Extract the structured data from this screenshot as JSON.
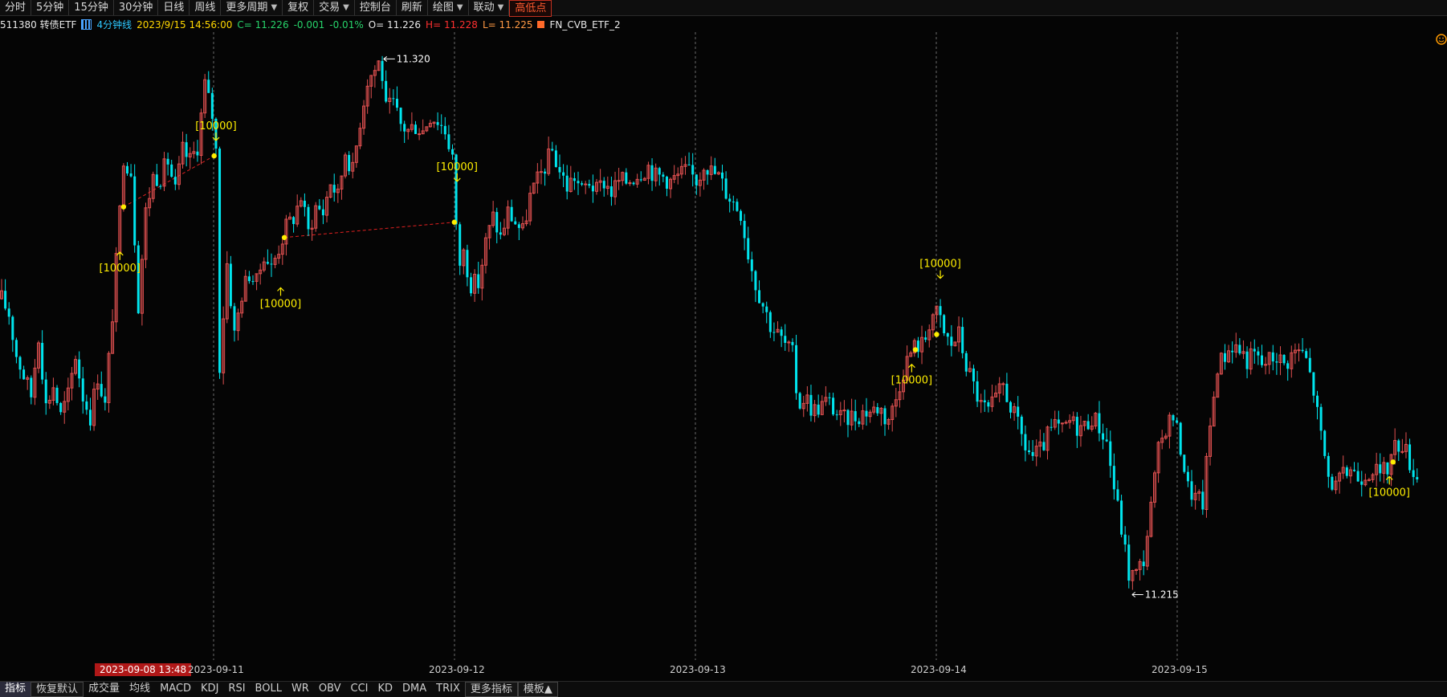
{
  "toolbar": {
    "items": [
      "分时",
      "5分钟",
      "15分钟",
      "30分钟",
      "日线",
      "周线",
      "更多周期",
      "复权",
      "交易",
      "控制台",
      "刷新",
      "绘图",
      "联动",
      "高低点"
    ]
  },
  "info": {
    "code": "511380 转债ETF",
    "period": "4分钟线",
    "datetime": "2023/9/15 14:56:00",
    "close": "C= 11.226",
    "change": "-0.001",
    "pct": "-0.01%",
    "open": "O= 11.226",
    "high": "H= 11.228",
    "low": "L= 11.225",
    "indicator": "FN_CVB_ETF_2"
  },
  "time_axis": {
    "cursor_label": "2023-09-08 13:48",
    "labels": [
      "2023-09-11",
      "2023-09-12",
      "2023-09-13",
      "2023-09-14",
      "2023-09-15"
    ]
  },
  "bottom": {
    "items": [
      "指标",
      "恢复默认",
      "成交量",
      "均线",
      "MACD",
      "KDJ",
      "RSI",
      "BOLL",
      "WR",
      "OBV",
      "CCI",
      "KD",
      "DMA",
      "TRIX",
      "更多指标",
      "模板▲"
    ]
  },
  "colors": {
    "up": "#e05050",
    "down": "#00e5ee",
    "signal": "#ffee00",
    "grid": "#6a6a6a",
    "label": "#ffffff"
  },
  "chart_data": {
    "type": "candlestick",
    "ylim": [
      11.208,
      11.324
    ],
    "high_label": "11.320",
    "low_label": "11.215",
    "signal_label": "[10000]",
    "day_markers": [
      "2023-09-11",
      "2023-09-12",
      "2023-09-13",
      "2023-09-14",
      "2023-09-15"
    ],
    "path": [
      [
        0,
        11.273
      ],
      [
        8,
        11.27
      ],
      [
        16,
        11.262
      ],
      [
        24,
        11.258
      ],
      [
        32,
        11.254
      ],
      [
        40,
        11.266
      ],
      [
        48,
        11.252
      ],
      [
        56,
        11.256
      ],
      [
        64,
        11.25
      ],
      [
        72,
        11.254
      ],
      [
        80,
        11.262
      ],
      [
        88,
        11.254
      ],
      [
        96,
        11.25
      ],
      [
        104,
        11.258
      ],
      [
        112,
        11.252
      ],
      [
        120,
        11.27
      ],
      [
        128,
        11.29
      ],
      [
        132,
        11.301
      ],
      [
        140,
        11.298
      ],
      [
        148,
        11.272
      ],
      [
        156,
        11.29
      ],
      [
        164,
        11.297
      ],
      [
        172,
        11.297
      ],
      [
        180,
        11.3
      ],
      [
        188,
        11.294
      ],
      [
        196,
        11.302
      ],
      [
        204,
        11.3
      ],
      [
        212,
        11.303
      ],
      [
        220,
        11.315
      ],
      [
        228,
        11.309
      ],
      [
        232,
        11.302
      ],
      [
        236,
        11.26
      ],
      [
        244,
        11.28
      ],
      [
        252,
        11.266
      ],
      [
        260,
        11.274
      ],
      [
        268,
        11.278
      ],
      [
        276,
        11.276
      ],
      [
        284,
        11.282
      ],
      [
        292,
        11.279
      ],
      [
        300,
        11.283
      ],
      [
        308,
        11.287
      ],
      [
        316,
        11.289
      ],
      [
        324,
        11.293
      ],
      [
        332,
        11.286
      ],
      [
        340,
        11.291
      ],
      [
        348,
        11.29
      ],
      [
        356,
        11.296
      ],
      [
        364,
        11.293
      ],
      [
        372,
        11.302
      ],
      [
        380,
        11.298
      ],
      [
        388,
        11.308
      ],
      [
        396,
        11.316
      ],
      [
        404,
        11.318
      ],
      [
        410,
        11.32
      ],
      [
        416,
        11.31
      ],
      [
        424,
        11.311
      ],
      [
        432,
        11.307
      ],
      [
        440,
        11.306
      ],
      [
        448,
        11.307
      ],
      [
        456,
        11.306
      ],
      [
        464,
        11.309
      ],
      [
        472,
        11.308
      ],
      [
        480,
        11.306
      ],
      [
        488,
        11.301
      ],
      [
        494,
        11.279
      ],
      [
        500,
        11.282
      ],
      [
        508,
        11.276
      ],
      [
        516,
        11.276
      ],
      [
        524,
        11.284
      ],
      [
        532,
        11.289
      ],
      [
        540,
        11.285
      ],
      [
        548,
        11.29
      ],
      [
        556,
        11.288
      ],
      [
        564,
        11.286
      ],
      [
        572,
        11.293
      ],
      [
        580,
        11.296
      ],
      [
        588,
        11.299
      ],
      [
        596,
        11.302
      ],
      [
        604,
        11.298
      ],
      [
        612,
        11.295
      ],
      [
        620,
        11.297
      ],
      [
        628,
        11.294
      ],
      [
        636,
        11.296
      ],
      [
        644,
        11.294
      ],
      [
        652,
        11.296
      ],
      [
        660,
        11.294
      ],
      [
        668,
        11.296
      ],
      [
        676,
        11.296
      ],
      [
        684,
        11.297
      ],
      [
        692,
        11.298
      ],
      [
        700,
        11.299
      ],
      [
        708,
        11.297
      ],
      [
        716,
        11.297
      ],
      [
        724,
        11.296
      ],
      [
        732,
        11.297
      ],
      [
        740,
        11.298
      ],
      [
        748,
        11.297
      ],
      [
        754,
        11.296
      ],
      [
        760,
        11.3
      ],
      [
        768,
        11.298
      ],
      [
        776,
        11.297
      ],
      [
        784,
        11.294
      ],
      [
        792,
        11.292
      ],
      [
        800,
        11.29
      ],
      [
        808,
        11.282
      ],
      [
        816,
        11.276
      ],
      [
        824,
        11.272
      ],
      [
        832,
        11.268
      ],
      [
        840,
        11.266
      ],
      [
        848,
        11.264
      ],
      [
        856,
        11.262
      ],
      [
        862,
        11.252
      ],
      [
        870,
        11.254
      ],
      [
        878,
        11.251
      ],
      [
        886,
        11.252
      ],
      [
        894,
        11.253
      ],
      [
        902,
        11.251
      ],
      [
        910,
        11.249
      ],
      [
        918,
        11.25
      ],
      [
        926,
        11.25
      ],
      [
        934,
        11.251
      ],
      [
        942,
        11.251
      ],
      [
        950,
        11.252
      ],
      [
        958,
        11.249
      ],
      [
        966,
        11.252
      ],
      [
        974,
        11.258
      ],
      [
        982,
        11.262
      ],
      [
        990,
        11.264
      ],
      [
        998,
        11.264
      ],
      [
        1006,
        11.27
      ],
      [
        1014,
        11.27
      ],
      [
        1020,
        11.266
      ],
      [
        1028,
        11.264
      ],
      [
        1036,
        11.266
      ],
      [
        1044,
        11.26
      ],
      [
        1052,
        11.256
      ],
      [
        1060,
        11.252
      ],
      [
        1068,
        11.251
      ],
      [
        1076,
        11.253
      ],
      [
        1084,
        11.256
      ],
      [
        1092,
        11.252
      ],
      [
        1100,
        11.248
      ],
      [
        1108,
        11.244
      ],
      [
        1116,
        11.242
      ],
      [
        1124,
        11.243
      ],
      [
        1132,
        11.246
      ],
      [
        1140,
        11.248
      ],
      [
        1148,
        11.247
      ],
      [
        1156,
        11.249
      ],
      [
        1164,
        11.248
      ],
      [
        1172,
        11.248
      ],
      [
        1180,
        11.25
      ],
      [
        1188,
        11.248
      ],
      [
        1196,
        11.245
      ],
      [
        1204,
        11.236
      ],
      [
        1212,
        11.228
      ],
      [
        1220,
        11.219
      ],
      [
        1228,
        11.219
      ],
      [
        1236,
        11.222
      ],
      [
        1244,
        11.232
      ],
      [
        1252,
        11.243
      ],
      [
        1260,
        11.248
      ],
      [
        1268,
        11.25
      ],
      [
        1276,
        11.244
      ],
      [
        1284,
        11.236
      ],
      [
        1292,
        11.234
      ],
      [
        1300,
        11.233
      ],
      [
        1308,
        11.248
      ],
      [
        1316,
        11.26
      ],
      [
        1324,
        11.262
      ],
      [
        1332,
        11.264
      ],
      [
        1340,
        11.263
      ],
      [
        1348,
        11.261
      ],
      [
        1356,
        11.262
      ],
      [
        1364,
        11.26
      ],
      [
        1372,
        11.261
      ],
      [
        1380,
        11.262
      ],
      [
        1388,
        11.26
      ],
      [
        1396,
        11.262
      ],
      [
        1404,
        11.263
      ],
      [
        1412,
        11.261
      ],
      [
        1420,
        11.255
      ],
      [
        1428,
        11.246
      ],
      [
        1436,
        11.238
      ],
      [
        1444,
        11.236
      ],
      [
        1452,
        11.238
      ],
      [
        1460,
        11.24
      ],
      [
        1468,
        11.238
      ],
      [
        1476,
        11.239
      ],
      [
        1484,
        11.24
      ],
      [
        1492,
        11.238
      ],
      [
        1500,
        11.24
      ],
      [
        1508,
        11.244
      ],
      [
        1516,
        11.245
      ],
      [
        1524,
        11.241
      ],
      [
        1532,
        11.238
      ]
    ],
    "signals": [
      {
        "x": 128,
        "dir": "buy",
        "label_y": 11.279
      },
      {
        "x": 302,
        "dir": "buy",
        "label_y": 11.272
      },
      {
        "x": 232,
        "dir": "sell",
        "label_y": 11.304
      },
      {
        "x": 493,
        "dir": "sell",
        "label_y": 11.296
      },
      {
        "x": 985,
        "dir": "buy",
        "label_y": 11.257
      },
      {
        "x": 1016,
        "dir": "sell",
        "label_y": 11.277
      },
      {
        "x": 1502,
        "dir": "buy",
        "label_y": 11.235
      }
    ],
    "dots": [
      [
        132,
        11.291
      ],
      [
        230,
        11.301
      ],
      [
        306,
        11.285
      ],
      [
        490,
        11.288
      ],
      [
        989,
        11.263
      ],
      [
        1012,
        11.266
      ],
      [
        1506,
        11.241
      ]
    ],
    "links": [
      [
        132,
        11.291,
        230,
        11.301
      ],
      [
        306,
        11.285,
        490,
        11.288
      ]
    ]
  }
}
